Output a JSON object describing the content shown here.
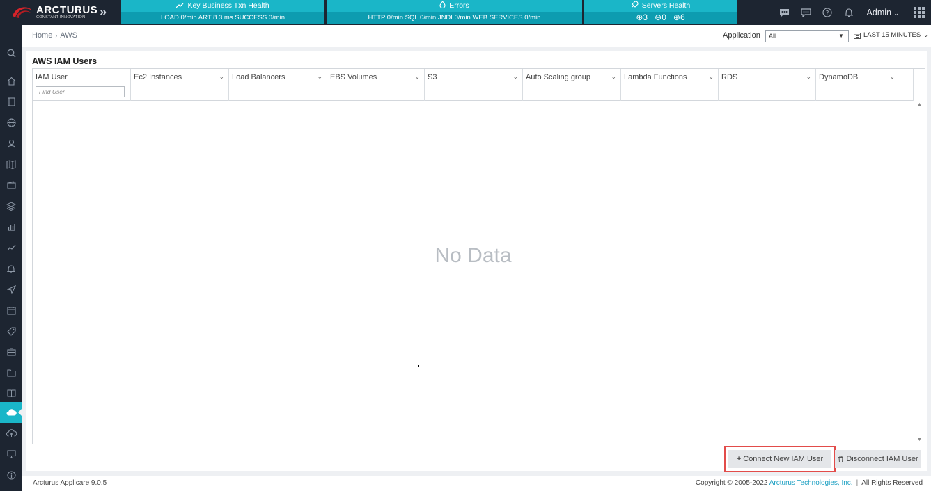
{
  "brand": {
    "name": "ARCTURUS",
    "tagline": "CONSTANT INNOVATION"
  },
  "header": {
    "panels": [
      {
        "title": "Key Business Txn Health",
        "icon": "trend-icon",
        "values": "LOAD 0/min   ART 8.3 ms   SUCCESS 0/min"
      },
      {
        "title": "Errors",
        "icon": "fire-icon",
        "values": "HTTP 0/min   SQL 0/min   JNDI 0/min   WEB SERVICES 0/min"
      },
      {
        "title": "Servers Health",
        "icon": "rocket-icon",
        "up": "3",
        "same": "0",
        "down": "6"
      }
    ],
    "user": "Admin"
  },
  "breadcrumb": {
    "home": "Home",
    "current": "AWS"
  },
  "filters": {
    "application_label": "Application",
    "application_value": "All",
    "time_range": "LAST 15 MINUTES"
  },
  "card": {
    "title": "AWS IAM Users",
    "columns": [
      "IAM User",
      "Ec2 Instances",
      "Load Balancers",
      "EBS Volumes",
      "S3",
      "Auto Scaling group",
      "Lambda Functions",
      "RDS",
      "DynamoDB"
    ],
    "find_placeholder": "Find User",
    "empty_text": "No Data",
    "connect_label": "Connect New IAM User",
    "disconnect_label": "Disconnect IAM User"
  },
  "footer": {
    "version": "Arcturus Applicare 9.0.5",
    "copyright": "Copyright © 2005-2022",
    "company": "Arcturus Technologies, Inc.",
    "rights": "All Rights Reserved"
  },
  "colors": {
    "accent": "#1ab6c8",
    "topbar": "#1d2531",
    "highlight": "#e24c4a"
  },
  "sidebar_icons": [
    "search-icon",
    "home-icon",
    "tablet-icon",
    "globe-icon",
    "user-icon",
    "map-icon",
    "wallet-icon",
    "layers-icon",
    "bar-chart-icon",
    "line-chart-icon",
    "bell-icon",
    "send-icon",
    "calendar-icon",
    "tag-icon",
    "briefcase-icon",
    "folder-icon",
    "book-icon",
    "cloud-icon",
    "cloud-upload-icon",
    "monitor-icon",
    "info-icon"
  ]
}
